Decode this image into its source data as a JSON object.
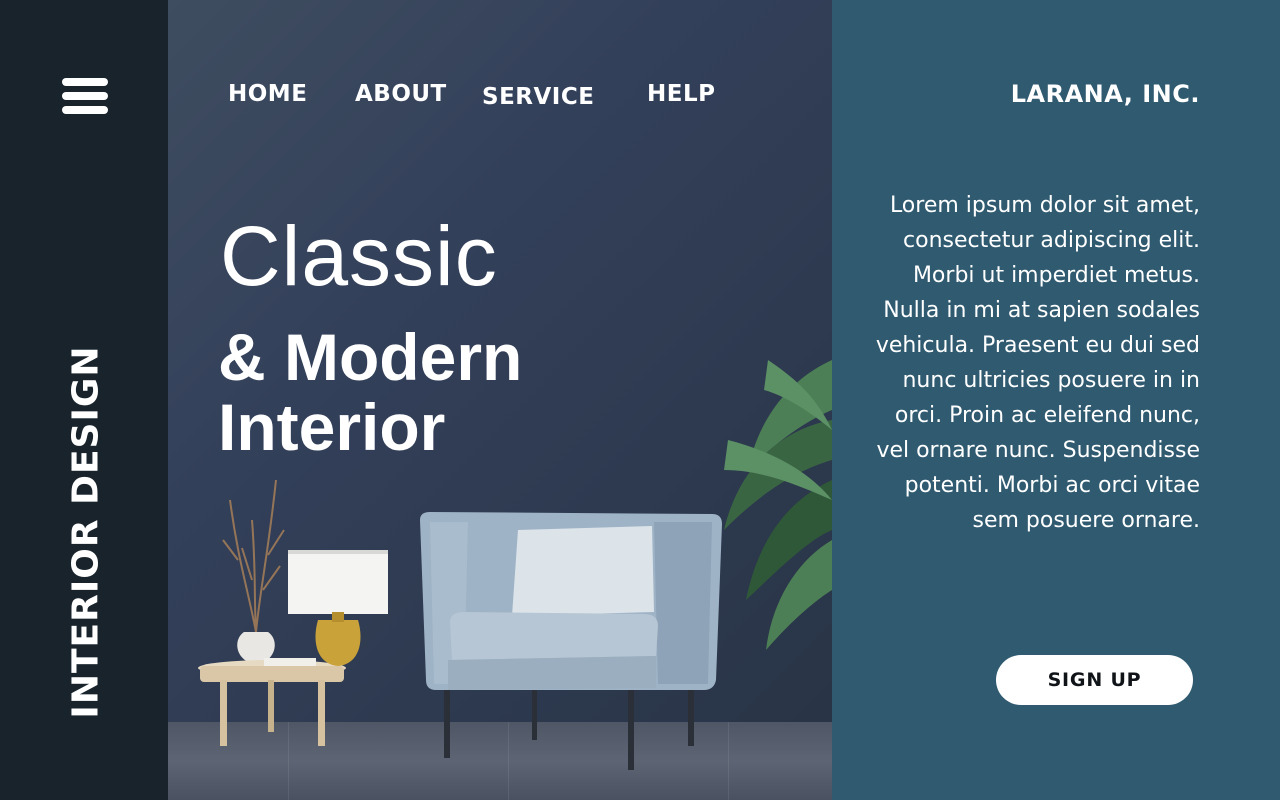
{
  "sidebar": {
    "menu_icon": "hamburger-menu-icon",
    "vertical_title": "INTERIOR DESIGN"
  },
  "nav": {
    "items": [
      {
        "label": "HOME"
      },
      {
        "label": "ABOUT"
      },
      {
        "label": "SERVICE"
      },
      {
        "label": "HELP"
      }
    ]
  },
  "hero": {
    "headline_line1": "Classic",
    "headline_line2": "& Modern",
    "headline_line3": "Interior",
    "scene": [
      "armchair",
      "table-lamp",
      "side-table",
      "vase-with-dry-branches",
      "palm-plant"
    ]
  },
  "panel": {
    "brand": "LARANA, INC.",
    "body": "Lorem ipsum dolor sit amet, consectetur adipiscing elit. Morbi ut imperdiet metus. Nulla in mi at sapien sodales vehicula. Praesent eu dui sed nunc ultricies posuere in in orci. Proin ac eleifend nunc, vel ornare nunc. Suspendisse potenti. Morbi ac orci vitae sem posuere ornare.",
    "cta_label": "SIGN UP"
  },
  "colors": {
    "rail": "#18232c",
    "hero_wall": "#2f3a4d",
    "panel": "#2f5a70",
    "text": "#ffffff",
    "button": "#ffffff",
    "button_text": "#101418"
  }
}
